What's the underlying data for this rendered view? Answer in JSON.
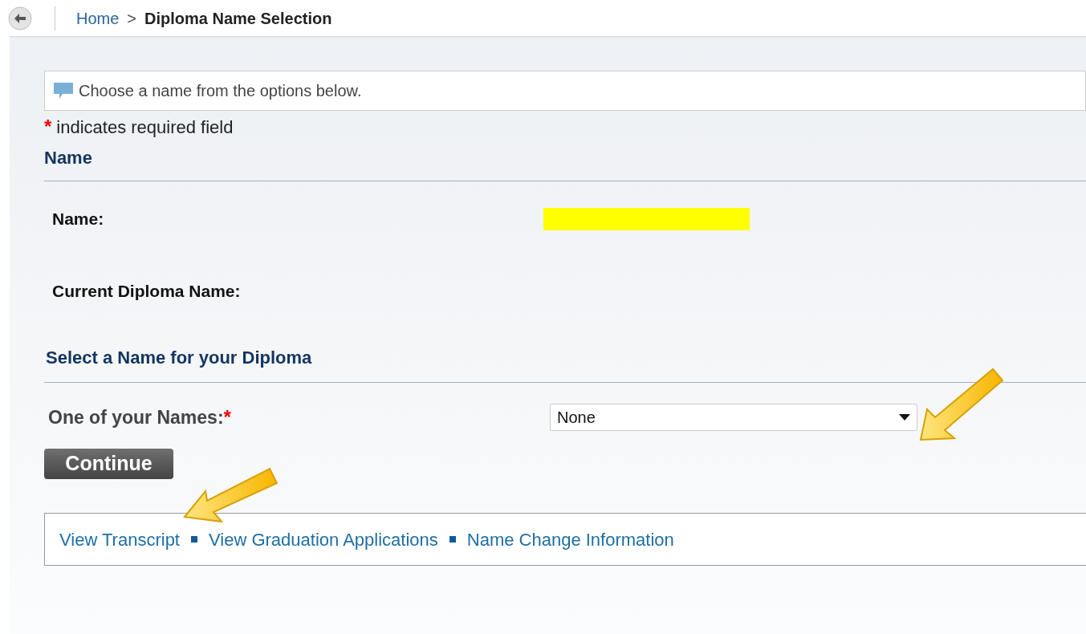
{
  "breadcrumb": {
    "home": "Home",
    "separator": ">",
    "current": "Diploma Name Selection"
  },
  "info_message": "Choose a name from the options below.",
  "required_note": {
    "marker": "*",
    "text": "indicates required field"
  },
  "name_section": {
    "heading": "Name",
    "fields": [
      {
        "label": "Name:",
        "redacted": true
      },
      {
        "label": "Current Diploma Name:",
        "redacted": false
      }
    ]
  },
  "select_section": {
    "heading": "Select a Name for your Diploma",
    "label": "One of your Names:",
    "required_marker": "*",
    "value": "None"
  },
  "continue_button": "Continue",
  "footer_links": [
    {
      "label": "View Transcript"
    },
    {
      "label": "View Graduation Applications"
    },
    {
      "label": "Name Change Information"
    }
  ]
}
